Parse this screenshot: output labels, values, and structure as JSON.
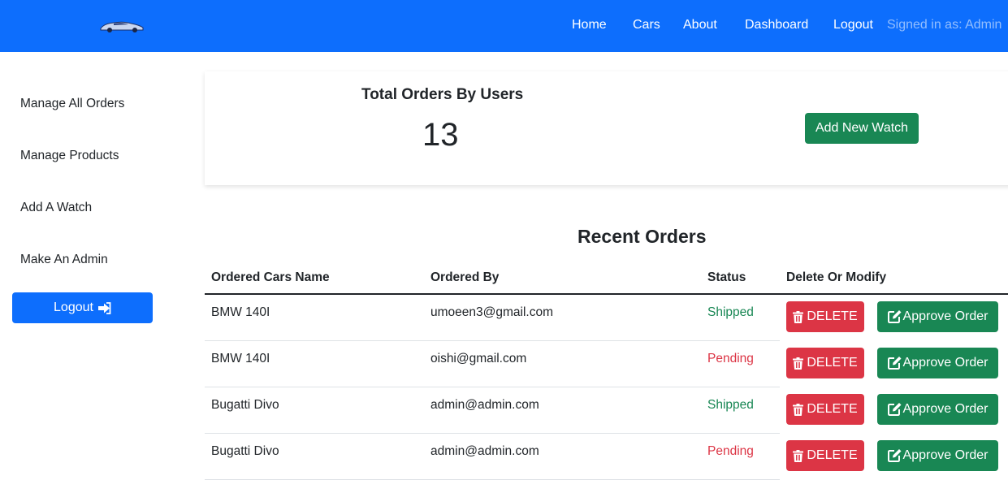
{
  "navbar": {
    "brand_icon": "car-logo",
    "links": [
      "Home",
      "Cars",
      "About",
      "Dashboard",
      "Logout"
    ],
    "signed_in": "Signed in as: Admin",
    "bg_color": "#0d6efd"
  },
  "sidebar": {
    "items": [
      "Manage All Orders",
      "Manage Products",
      "Add A Watch",
      "Make An Admin"
    ],
    "logout_label": "Logout",
    "logout_icon": "sign-out-icon"
  },
  "summary": {
    "title": "Total Orders By Users",
    "count": "13",
    "add_button": "Add New Watch"
  },
  "orders": {
    "title": "Recent Orders",
    "headers": [
      "Ordered Cars Name",
      "Ordered By",
      "Status",
      "Delete Or Modify"
    ],
    "rows": [
      {
        "car": "BMW 140I",
        "email": "umoeen3@gmail.com",
        "status": "Shipped"
      },
      {
        "car": "BMW 140I",
        "email": "oishi@gmail.com",
        "status": "Pending"
      },
      {
        "car": "Bugatti Divo",
        "email": "admin@admin.com",
        "status": "Shipped"
      },
      {
        "car": "Bugatti Divo",
        "email": "admin@admin.com",
        "status": "Pending"
      }
    ],
    "delete_label": "DELETE",
    "approve_label": "Approve Order",
    "status_colors": {
      "Shipped": "#198754",
      "Pending": "#dc3545"
    }
  }
}
